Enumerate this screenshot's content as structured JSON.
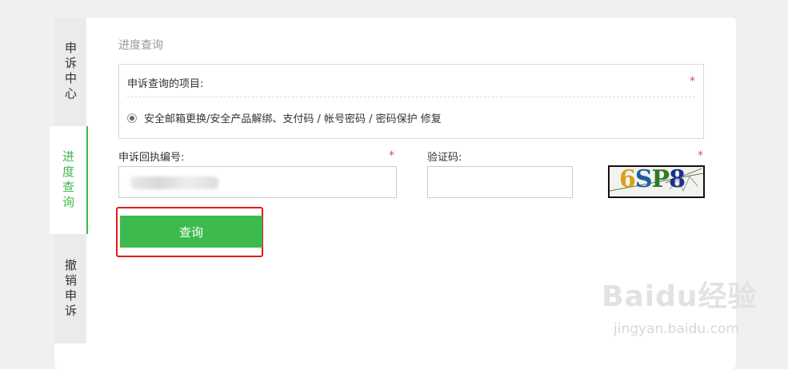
{
  "sidebar": {
    "tabs": [
      {
        "label": "申诉中心",
        "active": false
      },
      {
        "label": "进度查询",
        "active": true
      },
      {
        "label": "撤销申诉",
        "active": false
      }
    ]
  },
  "main": {
    "section_title": "进度查询",
    "project_box": {
      "label": "申诉查询的项目:",
      "required_mark": "*",
      "option_label": "安全邮箱更换/安全产品解绑、支付码 / 帐号密码 / 密码保护 修复"
    },
    "receipt_field": {
      "label": "申诉回执编号:",
      "required_mark": "*",
      "value": ""
    },
    "captcha_field": {
      "label": "验证码:",
      "required_mark": "*",
      "value": "",
      "captcha_text": "6SP8"
    },
    "query_button": {
      "label": "查询"
    }
  },
  "colors": {
    "accent_green": "#3dba4d",
    "required_red": "#e04a4a",
    "highlight_red": "#e21b1b"
  },
  "watermark": {
    "main": "Baidu经验",
    "sub": "jingyan.baidu.com"
  }
}
